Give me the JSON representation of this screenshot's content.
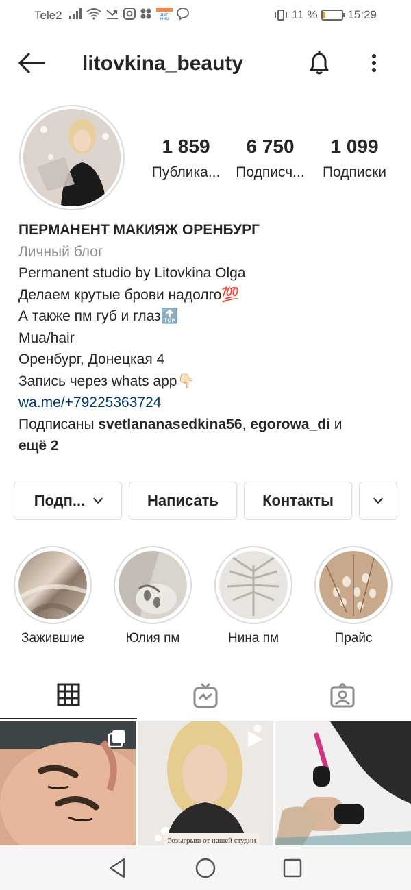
{
  "status_bar": {
    "carrier": "Tele2",
    "battery_percent": "11 %",
    "battery_level": 0.11,
    "battery_color": "#f0a020",
    "time": "15:29",
    "icons": [
      "signal-icon",
      "wifi-icon",
      "missed-call-icon",
      "instagram-icon",
      "app-icon",
      "detmir-icon",
      "viber-icon",
      "vibrate-icon"
    ]
  },
  "header": {
    "username": "litovkina_beauty"
  },
  "stats": [
    {
      "value": "1 859",
      "label": "Публика..."
    },
    {
      "value": "6 750",
      "label": "Подписч..."
    },
    {
      "value": "1 099",
      "label": "Подписки"
    }
  ],
  "bio": {
    "name": "ПЕРМАНЕНТ МАКИЯЖ ОРЕНБУРГ",
    "category": "Личный блог",
    "lines": [
      "Permanent studio by Litovkina Olga",
      "Делаем крутые брови надолго💯",
      "А также пм губ и глаз🔝",
      "Mua/hair",
      "Оренбург, Донецкая 4",
      "Запись через whats app👇🏻"
    ],
    "link": "wa.me/+79225363724",
    "followed_prefix": "Подписаны ",
    "followed_user1": "svetlananasedkina56",
    "followed_sep": ", ",
    "followed_user2": "egorowa_di",
    "followed_and": " и",
    "followed_more": "ещё 2"
  },
  "buttons": {
    "follow": "Подп...",
    "message": "Написать",
    "contacts": "Контакты"
  },
  "highlights": [
    {
      "label": "Зажившие"
    },
    {
      "label": "Юлия пм"
    },
    {
      "label": "Нина пм"
    },
    {
      "label": "Прайс"
    }
  ],
  "posts": [
    {
      "type": "carousel"
    },
    {
      "type": "video",
      "caption": "Розыгрыш от нашей студии"
    },
    {
      "type": "photo"
    }
  ],
  "colors": {
    "text": "#262626",
    "secondary": "#8e8e8e",
    "link": "#00376b",
    "border": "#dbdbdb"
  }
}
